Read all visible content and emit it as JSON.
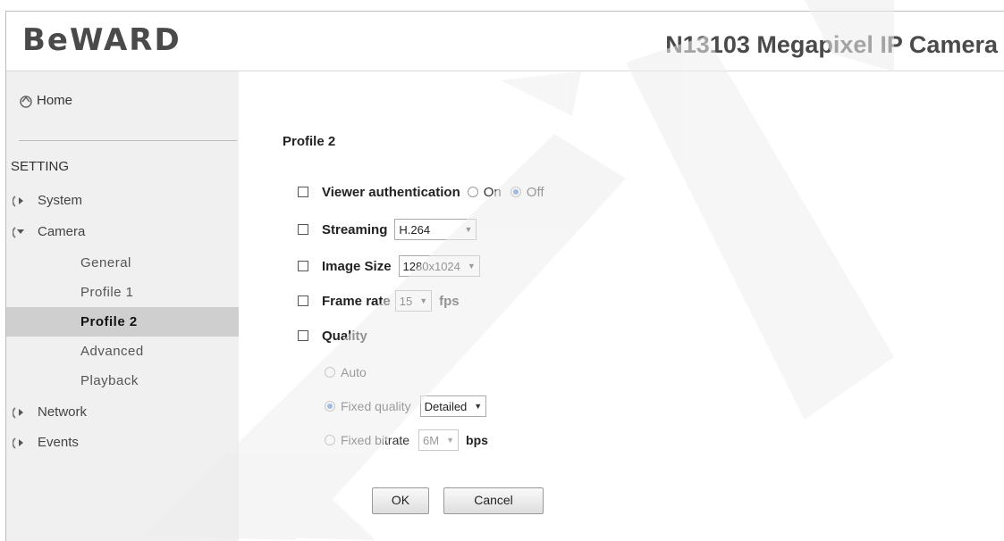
{
  "header": {
    "logo": "BeWARD",
    "product_title": "N13103 Megapixel IP Camera"
  },
  "sidebar": {
    "home_label": "Home",
    "section_label": "SETTING",
    "items": [
      {
        "label": "System"
      },
      {
        "label": "Camera"
      },
      {
        "label": "Network"
      },
      {
        "label": "Events"
      }
    ],
    "camera_subitems": [
      {
        "label": "General"
      },
      {
        "label": "Profile 1"
      },
      {
        "label": "Profile 2",
        "active": true
      },
      {
        "label": "Advanced"
      },
      {
        "label": "Playback"
      }
    ]
  },
  "main": {
    "title": "Profile 2",
    "viewer_auth": {
      "label": "Viewer authentication",
      "on_label": "On",
      "off_label": "Off",
      "selected": "Off"
    },
    "streaming": {
      "label": "Streaming",
      "value": "H.264"
    },
    "image_size": {
      "label": "Image Size",
      "value": "1280x1024"
    },
    "frame_rate": {
      "label": "Frame rate",
      "value": "15",
      "unit": "fps"
    },
    "quality": {
      "label": "Quality",
      "auto_label": "Auto",
      "fixed_quality_label": "Fixed quality",
      "fixed_quality_value": "Detailed",
      "fixed_bitrate_label": "Fixed bitrate",
      "fixed_bitrate_value": "6M",
      "fixed_bitrate_unit": "bps",
      "selected": "Fixed quality"
    },
    "ok_label": "OK",
    "cancel_label": "Cancel"
  },
  "colors": {
    "radio_selected": "#4a7ad0",
    "sidebar_bg": "#f0f0f0",
    "active_item_bg": "#cfcfcf"
  }
}
